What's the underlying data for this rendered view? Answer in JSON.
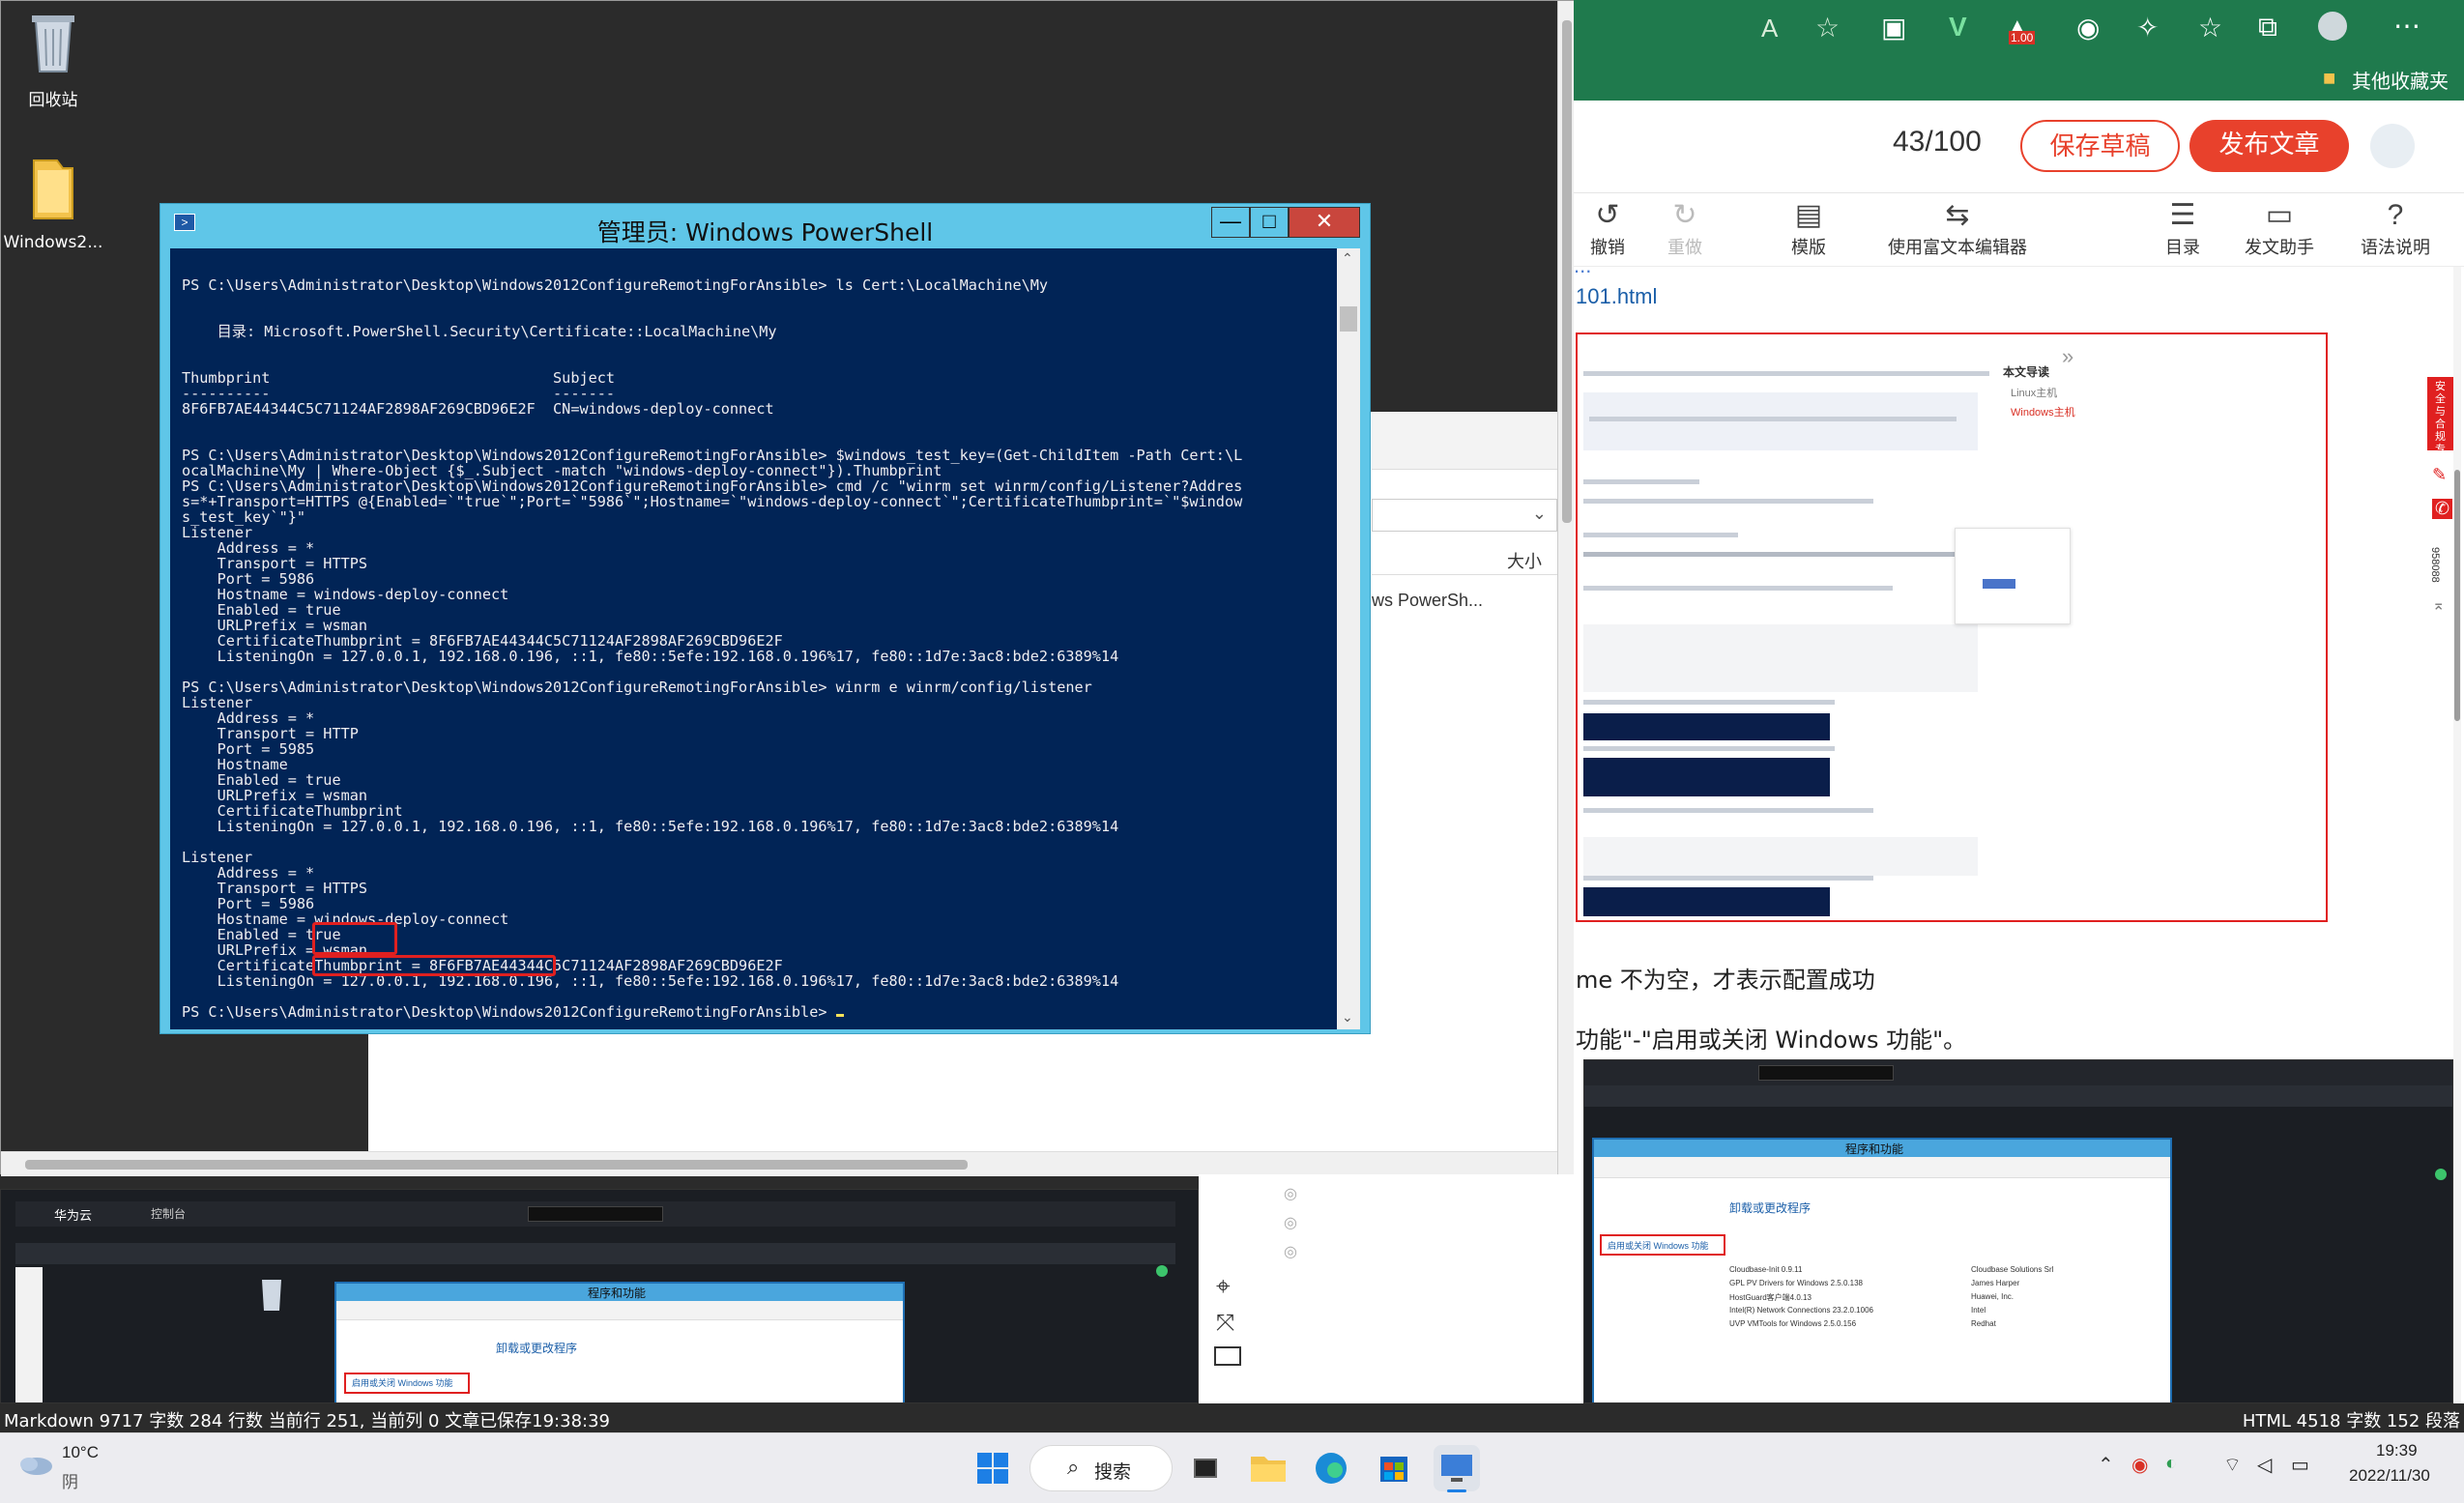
{
  "desktop": {
    "icons": [
      {
        "label": "回收站",
        "name": "recycle-bin"
      },
      {
        "label": "Windows2...",
        "name": "folder"
      }
    ]
  },
  "powershell": {
    "title": "管理员: Windows PowerShell",
    "buttons": {
      "minimize": "—",
      "maximize": "□",
      "close": "✕"
    },
    "lines": [
      "PS C:\\Users\\Administrator\\Desktop\\Windows2012ConfigureRemotingForAnsible> ls Cert:\\LocalMachine\\My",
      "",
      "",
      "    目录: Microsoft.PowerShell.Security\\Certificate::LocalMachine\\My",
      "",
      "",
      "Thumbprint                                Subject",
      "----------                                -------",
      "8F6FB7AE44344C5C71124AF2898AF269CBD96E2F  CN=windows-deploy-connect",
      "",
      "",
      "PS C:\\Users\\Administrator\\Desktop\\Windows2012ConfigureRemotingForAnsible> $windows_test_key=(Get-ChildItem -Path Cert:\\L",
      "ocalMachine\\My | Where-Object {$_.Subject -match \"windows-deploy-connect\"}).Thumbprint",
      "PS C:\\Users\\Administrator\\Desktop\\Windows2012ConfigureRemotingForAnsible> cmd /c \"winrm set winrm/config/Listener?Addres",
      "s=*+Transport=HTTPS @{Enabled=`\"true`\";Port=`\"5986`\";Hostname=`\"windows-deploy-connect`\";CertificateThumbprint=`\"$window",
      "s_test_key`\"}\"",
      "Listener",
      "    Address = *",
      "    Transport = HTTPS",
      "    Port = 5986",
      "    Hostname = windows-deploy-connect",
      "    Enabled = true",
      "    URLPrefix = wsman",
      "    CertificateThumbprint = 8F6FB7AE44344C5C71124AF2898AF269CBD96E2F",
      "    ListeningOn = 127.0.0.1, 192.168.0.196, ::1, fe80::5efe:192.168.0.196%17, fe80::1d7e:3ac8:bde2:6389%14",
      "",
      "PS C:\\Users\\Administrator\\Desktop\\Windows2012ConfigureRemotingForAnsible> winrm e winrm/config/listener",
      "Listener",
      "    Address = *",
      "    Transport = HTTP",
      "    Port = 5985",
      "    Hostname",
      "    Enabled = true",
      "    URLPrefix = wsman",
      "    CertificateThumbprint",
      "    ListeningOn = 127.0.0.1, 192.168.0.196, ::1, fe80::5efe:192.168.0.196%17, fe80::1d7e:3ac8:bde2:6389%14",
      "",
      "Listener",
      "    Address = *",
      "    Transport = HTTPS",
      "    Port = 5986",
      "    Hostname = windows-deploy-connect",
      "    Enabled = true",
      "    URLPrefix = wsman",
      "    CertificateThumbprint = 8F6FB7AE44344C5C71124AF2898AF269CBD96E2F",
      "    ListeningOn = 127.0.0.1, 192.168.0.196, ::1, fe80::5efe:192.168.0.196%17, fe80::1d7e:3ac8:bde2:6389%14",
      "",
      "PS C:\\Users\\Administrator\\Desktop\\Windows2012ConfigureRemotingForAnsible> _"
    ]
  },
  "background_window": {
    "column_header": "大小",
    "item_text": "ws PowerSh..."
  },
  "browser": {
    "other_bookmarks": "其他收藏夹",
    "word_count": "43/100",
    "save_draft": "保存草稿",
    "publish": "发布文章",
    "toolbar": [
      {
        "label": "撤销",
        "icon": "undo-icon",
        "disabled": false
      },
      {
        "label": "重做",
        "icon": "redo-icon",
        "disabled": true
      },
      {
        "label": "模版",
        "icon": "template-icon",
        "disabled": false
      },
      {
        "label": "使用富文本编辑器",
        "icon": "switch-icon",
        "disabled": false
      },
      {
        "label": "目录",
        "icon": "toc-icon",
        "disabled": false
      },
      {
        "label": "发文助手",
        "icon": "assistant-icon",
        "disabled": false
      },
      {
        "label": "语法说明",
        "icon": "help-icon",
        "disabled": false
      }
    ],
    "link_partial": "101.html",
    "link_partial_top": "...",
    "text_line_1": "me 不为空，才表示配置成功",
    "text_line_2": "功能\"-\"启用或关闭 Windows 功能\"。",
    "toc_label": "本文导读",
    "toc_items": [
      "Linux主机",
      "Windows主机"
    ],
    "side_labels": [
      "安全与合规专区",
      "958088"
    ],
    "thumb_header": "程序和功能",
    "thumb_link": "卸载或更改程序",
    "thumb_side": "启用或关闭 Windows 功能",
    "thumb_rows": [
      [
        "Cloudbase-Init 0.9.11",
        "Cloudbase Solutions Srl"
      ],
      [
        "GPL PV Drivers for Windows 2.5.0.138",
        "James Harper"
      ],
      [
        "HostGuard客户端4.0.13",
        "Huawei, Inc."
      ],
      [
        "Intel(R) Network Connections 23.2.0.1006",
        "Intel"
      ],
      [
        "UVP VMTools for Windows 2.5.0.156",
        "Redhat"
      ]
    ]
  },
  "bottom_thumb": {
    "brand": "华为云",
    "console": "控制台",
    "title": "程序和功能",
    "link": "卸载或更改程序",
    "side": "启用或关闭 Windows 功能"
  },
  "status": {
    "left": "Markdown  9717 字数  284 行数  当前行 251, 当前列 0  文章已保存19:38:39",
    "right": "HTML  4518 字数  152 段落"
  },
  "taskbar": {
    "weather_temp": "10°C",
    "weather_desc": "阴",
    "search": "搜索",
    "time": "19:39",
    "date": "2022/11/30"
  },
  "colors": {
    "ps_bg": "#012456",
    "ps_frame": "#5fc6e8",
    "browser_green": "#1f7a4d",
    "publish_red": "#e8412c",
    "highlight_red": "#e02020"
  }
}
